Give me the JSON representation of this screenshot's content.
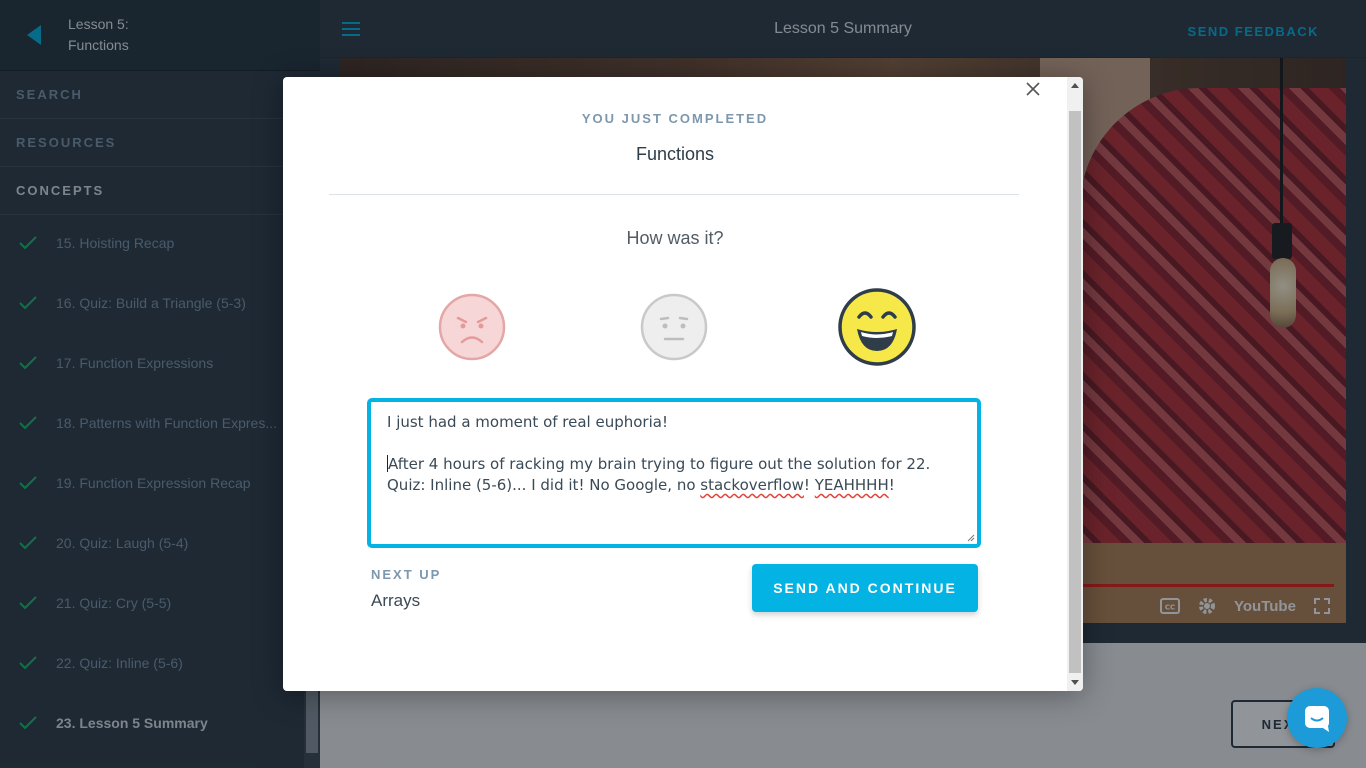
{
  "sidebar": {
    "lesson_title_line1": "Lesson 5:",
    "lesson_title_line2": "Functions",
    "sections": [
      "SEARCH",
      "RESOURCES",
      "CONCEPTS"
    ],
    "concepts": [
      {
        "label": "15. Hoisting Recap",
        "completed": true
      },
      {
        "label": "16. Quiz: Build a Triangle (5-3)",
        "completed": true
      },
      {
        "label": "17. Function Expressions",
        "completed": true
      },
      {
        "label": "18. Patterns with Function Expres...",
        "completed": true
      },
      {
        "label": "19. Function Expression Recap",
        "completed": true
      },
      {
        "label": "20. Quiz: Laugh (5-4)",
        "completed": true
      },
      {
        "label": "21. Quiz: Cry (5-5)",
        "completed": true
      },
      {
        "label": "22. Quiz: Inline (5-6)",
        "completed": true
      },
      {
        "label": "23. Lesson 5 Summary",
        "completed": true,
        "current": true
      }
    ]
  },
  "topbar": {
    "title": "Lesson 5 Summary",
    "feedback_label": "SEND FEEDBACK"
  },
  "video": {
    "brand": "YouTube",
    "cc_label": "CC"
  },
  "footer": {
    "next_label": "NEXT"
  },
  "modal": {
    "kicker": "YOU JUST COMPLETED",
    "title": "Functions",
    "question": "How was it?",
    "ratings": [
      "sad",
      "neutral",
      "happy"
    ],
    "selected_rating": "happy",
    "feedback": {
      "line1": "I just had a moment of real euphoria!",
      "line2": "After 4 hours of racking my brain trying to figure out the solution for 22.",
      "line3_a": "Quiz: Inline (5-6)... I did it! No Google, no ",
      "line3_b": "stackoverflow",
      "line3_c": "! ",
      "line3_d": "YEAHHHH",
      "line3_e": "!"
    },
    "next_up_label": "NEXT UP",
    "next_up_value": "Arrays",
    "send_label": "SEND AND CONTINUE"
  },
  "colors": {
    "accent": "#02b3e4",
    "sidebar_bg": "#2e3d49",
    "check": "#15c26b",
    "happy_face": "#f7e84a"
  }
}
